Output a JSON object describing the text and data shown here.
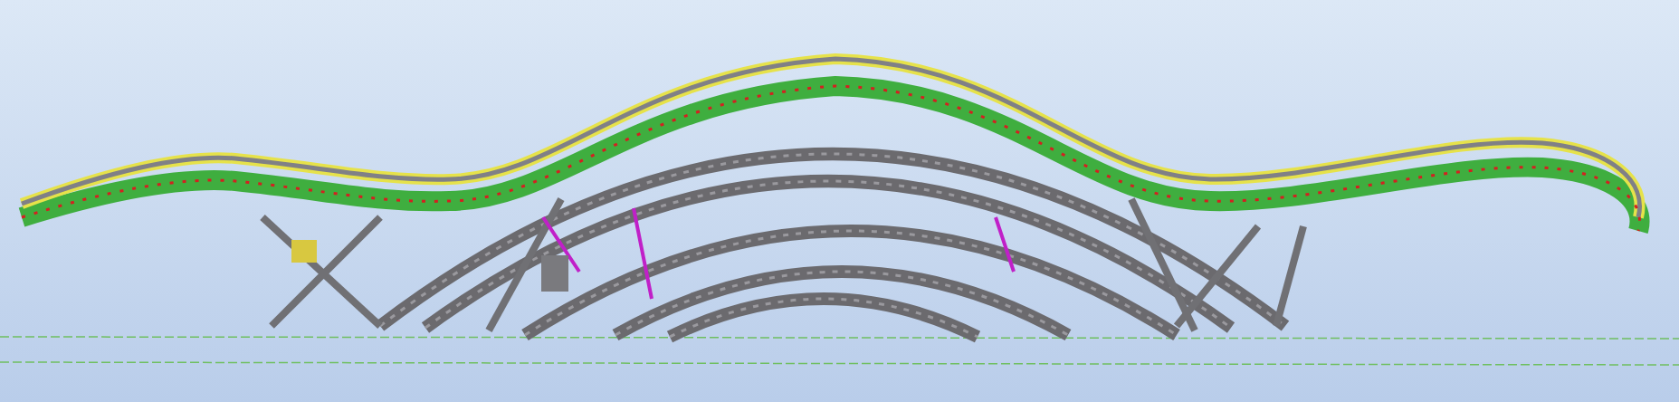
{
  "viewport": {
    "kind": "bridge-model"
  }
}
